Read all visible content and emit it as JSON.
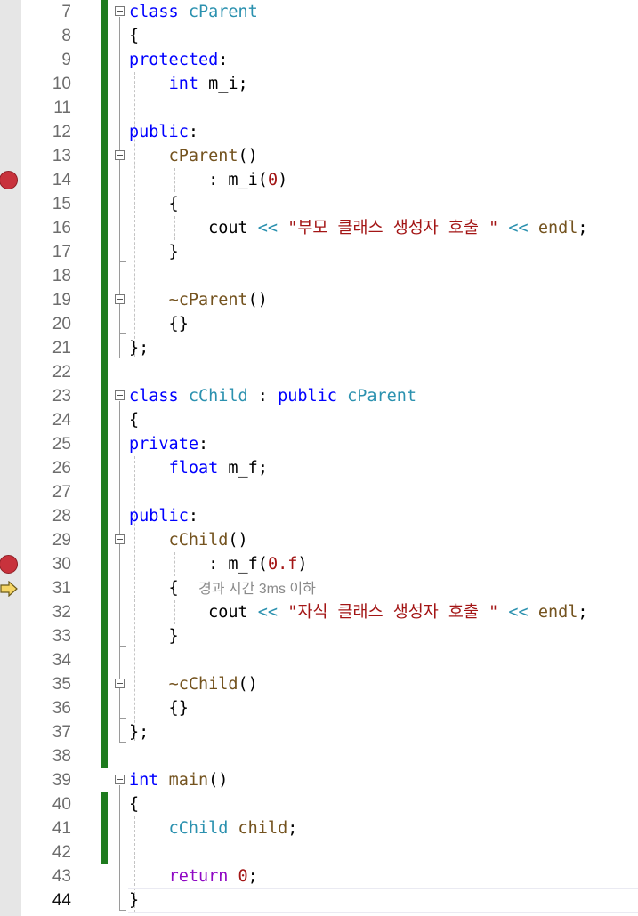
{
  "editor": {
    "current_line": "44",
    "breakpoint_lines": [
      "14",
      "30"
    ],
    "instruction_pointer_line": "31",
    "perf_hint": "경과 시간 3ms 이하",
    "colors": {
      "keyword": "#0000ff",
      "type": "#2b91af",
      "function": "#74531f",
      "string": "#a31515",
      "change_bar": "#1e7b1e",
      "breakpoint": "#c8323c"
    }
  },
  "lines": [
    {
      "n": "7",
      "tokens": [
        [
          "kw",
          "class"
        ],
        [
          "p",
          " "
        ],
        [
          "ty",
          "cParent"
        ]
      ]
    },
    {
      "n": "8",
      "tokens": [
        [
          "p",
          "{"
        ]
      ]
    },
    {
      "n": "9",
      "tokens": [
        [
          "kw",
          "protected"
        ],
        [
          "p",
          ":"
        ]
      ]
    },
    {
      "n": "10",
      "tokens": [
        [
          "p",
          "    "
        ],
        [
          "kw",
          "int"
        ],
        [
          "p",
          " m_i;"
        ]
      ]
    },
    {
      "n": "11",
      "tokens": []
    },
    {
      "n": "12",
      "tokens": [
        [
          "kw",
          "public"
        ],
        [
          "p",
          ":"
        ]
      ]
    },
    {
      "n": "13",
      "tokens": [
        [
          "p",
          "    "
        ],
        [
          "fn",
          "cParent"
        ],
        [
          "p",
          "()"
        ]
      ]
    },
    {
      "n": "14",
      "tokens": [
        [
          "p",
          "        : m_i("
        ],
        [
          "nm",
          "0"
        ],
        [
          "p",
          ")"
        ]
      ]
    },
    {
      "n": "15",
      "tokens": [
        [
          "p",
          "    {"
        ]
      ]
    },
    {
      "n": "16",
      "tokens": [
        [
          "p",
          "        cout "
        ],
        [
          "ty",
          "<<"
        ],
        [
          "p",
          " "
        ],
        [
          "st",
          "\"부모 클래스 생성자 호출 \""
        ],
        [
          "p",
          " "
        ],
        [
          "ty",
          "<<"
        ],
        [
          "p",
          " "
        ],
        [
          "fn",
          "endl"
        ],
        [
          "p",
          ";"
        ]
      ]
    },
    {
      "n": "17",
      "tokens": [
        [
          "p",
          "    }"
        ]
      ]
    },
    {
      "n": "18",
      "tokens": []
    },
    {
      "n": "19",
      "tokens": [
        [
          "p",
          "    "
        ],
        [
          "fn",
          "~cParent"
        ],
        [
          "p",
          "()"
        ]
      ]
    },
    {
      "n": "20",
      "tokens": [
        [
          "p",
          "    {}"
        ]
      ]
    },
    {
      "n": "21",
      "tokens": [
        [
          "p",
          "};"
        ]
      ]
    },
    {
      "n": "22",
      "tokens": []
    },
    {
      "n": "23",
      "tokens": [
        [
          "kw",
          "class"
        ],
        [
          "p",
          " "
        ],
        [
          "ty",
          "cChild"
        ],
        [
          "p",
          " : "
        ],
        [
          "kw",
          "public"
        ],
        [
          "p",
          " "
        ],
        [
          "ty",
          "cParent"
        ]
      ]
    },
    {
      "n": "24",
      "tokens": [
        [
          "p",
          "{"
        ]
      ]
    },
    {
      "n": "25",
      "tokens": [
        [
          "kw",
          "private"
        ],
        [
          "p",
          ":"
        ]
      ]
    },
    {
      "n": "26",
      "tokens": [
        [
          "p",
          "    "
        ],
        [
          "kw",
          "float"
        ],
        [
          "p",
          " m_f;"
        ]
      ]
    },
    {
      "n": "27",
      "tokens": []
    },
    {
      "n": "28",
      "tokens": [
        [
          "kw",
          "public"
        ],
        [
          "p",
          ":"
        ]
      ]
    },
    {
      "n": "29",
      "tokens": [
        [
          "p",
          "    "
        ],
        [
          "fn",
          "cChild"
        ],
        [
          "p",
          "()"
        ]
      ]
    },
    {
      "n": "30",
      "tokens": [
        [
          "p",
          "        : m_f("
        ],
        [
          "nm",
          "0.f"
        ],
        [
          "p",
          ")"
        ]
      ]
    },
    {
      "n": "31",
      "tokens": [
        [
          "p",
          "    {  "
        ],
        [
          "hint",
          "경과 시간 3ms 이하"
        ]
      ]
    },
    {
      "n": "32",
      "tokens": [
        [
          "p",
          "        cout "
        ],
        [
          "ty",
          "<<"
        ],
        [
          "p",
          " "
        ],
        [
          "st",
          "\"자식 클래스 생성자 호출 \""
        ],
        [
          "p",
          " "
        ],
        [
          "ty",
          "<<"
        ],
        [
          "p",
          " "
        ],
        [
          "fn",
          "endl"
        ],
        [
          "p",
          ";"
        ]
      ]
    },
    {
      "n": "33",
      "tokens": [
        [
          "p",
          "    }"
        ]
      ]
    },
    {
      "n": "34",
      "tokens": []
    },
    {
      "n": "35",
      "tokens": [
        [
          "p",
          "    "
        ],
        [
          "fn",
          "~cChild"
        ],
        [
          "p",
          "()"
        ]
      ]
    },
    {
      "n": "36",
      "tokens": [
        [
          "p",
          "    {}"
        ]
      ]
    },
    {
      "n": "37",
      "tokens": [
        [
          "p",
          "};"
        ]
      ]
    },
    {
      "n": "38",
      "tokens": []
    },
    {
      "n": "39",
      "tokens": [
        [
          "kw",
          "int"
        ],
        [
          "p",
          " "
        ],
        [
          "fn",
          "main"
        ],
        [
          "p",
          "()"
        ]
      ]
    },
    {
      "n": "40",
      "tokens": [
        [
          "p",
          "{"
        ]
      ]
    },
    {
      "n": "41",
      "tokens": [
        [
          "p",
          "    "
        ],
        [
          "ty",
          "cChild"
        ],
        [
          "p",
          " "
        ],
        [
          "fn",
          "child"
        ],
        [
          "p",
          ";"
        ]
      ]
    },
    {
      "n": "42",
      "tokens": []
    },
    {
      "n": "43",
      "tokens": [
        [
          "p",
          "    "
        ],
        [
          "kwp",
          "return"
        ],
        [
          "p",
          " "
        ],
        [
          "nm",
          "0"
        ],
        [
          "p",
          ";"
        ]
      ]
    },
    {
      "n": "44",
      "tokens": [
        [
          "p",
          "}"
        ]
      ]
    }
  ]
}
